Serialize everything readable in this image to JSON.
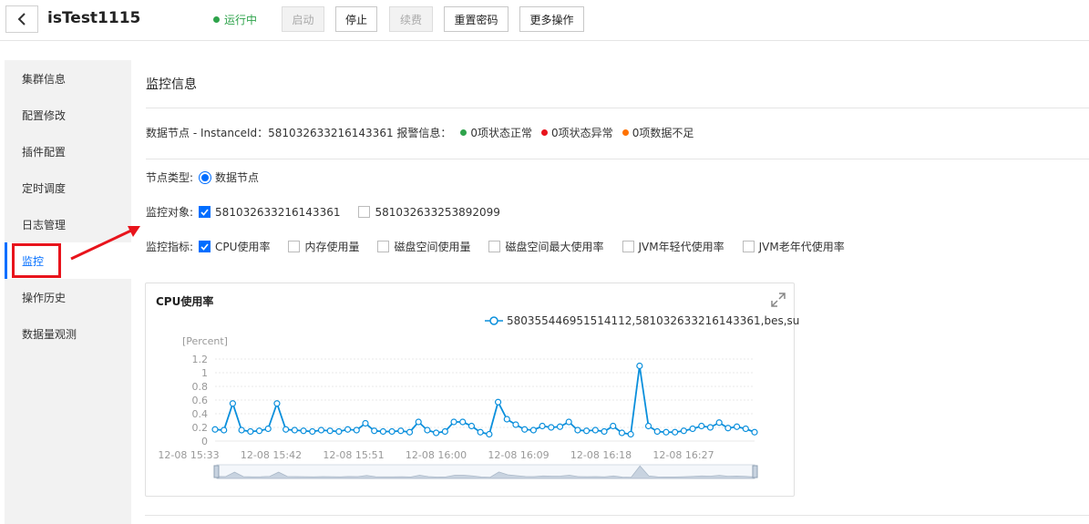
{
  "header": {
    "title": "isTest1115",
    "status": "运行中",
    "buttons": {
      "start": "启动",
      "stop": "停止",
      "renew": "续费",
      "reset_password": "重置密码",
      "more": "更多操作"
    }
  },
  "sidebar": {
    "items": [
      {
        "label": "集群信息"
      },
      {
        "label": "配置修改"
      },
      {
        "label": "插件配置"
      },
      {
        "label": "定时调度"
      },
      {
        "label": "日志管理"
      },
      {
        "label": "监控"
      },
      {
        "label": "操作历史"
      },
      {
        "label": "数据量观测"
      }
    ],
    "active_index": 5
  },
  "main": {
    "section_title": "监控信息",
    "alarm": {
      "prefix": "数据节点 - InstanceId：581032633216143361 报警信息：",
      "normal": "0项状态正常",
      "abnormal": "0项状态异常",
      "insufficient": "0项数据不足",
      "colors": {
        "normal": "#2ea34b",
        "abnormal": "#e8141c",
        "insufficient": "#ff7200"
      }
    },
    "node_type": {
      "label": "节点类型:",
      "option": "数据节点"
    },
    "target": {
      "label": "监控对象:",
      "options": [
        {
          "label": "581032633216143361",
          "checked": true
        },
        {
          "label": "581032633253892099",
          "checked": false
        }
      ]
    },
    "metrics": {
      "label": "监控指标:",
      "options": [
        {
          "label": "CPU使用率",
          "checked": true
        },
        {
          "label": "内存使用量",
          "checked": false
        },
        {
          "label": "磁盘空间使用量",
          "checked": false
        },
        {
          "label": "磁盘空间最大使用率",
          "checked": false
        },
        {
          "label": "JVM年轻代使用率",
          "checked": false
        },
        {
          "label": "JVM老年代使用率",
          "checked": false
        }
      ]
    }
  },
  "chart_card": {
    "title": "CPU使用率",
    "legend": "580355446951514112,581032633216143361,bes,su",
    "icons": {
      "expand": "expand-icon"
    }
  },
  "chart_data": {
    "type": "line",
    "title": "CPU使用率",
    "ylabel": "[Percent]",
    "ylim": [
      0,
      1.2
    ],
    "yticks": [
      "0",
      "0.2",
      "0.4",
      "0.6",
      "0.8",
      "1",
      "1.2"
    ],
    "xticks": [
      "12-08 15:33",
      "12-08 15:42",
      "12-08 15:51",
      "12-08 16:00",
      "12-08 16:09",
      "12-08 16:18",
      "12-08 16:27"
    ],
    "grid": true,
    "legend_position": "top-right",
    "color": "#0a8fdc",
    "series": [
      {
        "name": "580355446951514112,581032633216143361,bes,su",
        "values": [
          0.17,
          0.16,
          0.55,
          0.16,
          0.14,
          0.15,
          0.18,
          0.55,
          0.17,
          0.16,
          0.15,
          0.14,
          0.16,
          0.15,
          0.14,
          0.17,
          0.16,
          0.26,
          0.15,
          0.14,
          0.14,
          0.15,
          0.13,
          0.28,
          0.16,
          0.12,
          0.14,
          0.28,
          0.28,
          0.22,
          0.13,
          0.1,
          0.57,
          0.32,
          0.24,
          0.17,
          0.16,
          0.22,
          0.2,
          0.21,
          0.28,
          0.16,
          0.15,
          0.16,
          0.14,
          0.22,
          0.12,
          0.1,
          1.1,
          0.22,
          0.14,
          0.13,
          0.13,
          0.15,
          0.18,
          0.22,
          0.2,
          0.27,
          0.19,
          0.21,
          0.18,
          0.13
        ]
      }
    ]
  },
  "annotation": {
    "color": "#e8141c"
  }
}
